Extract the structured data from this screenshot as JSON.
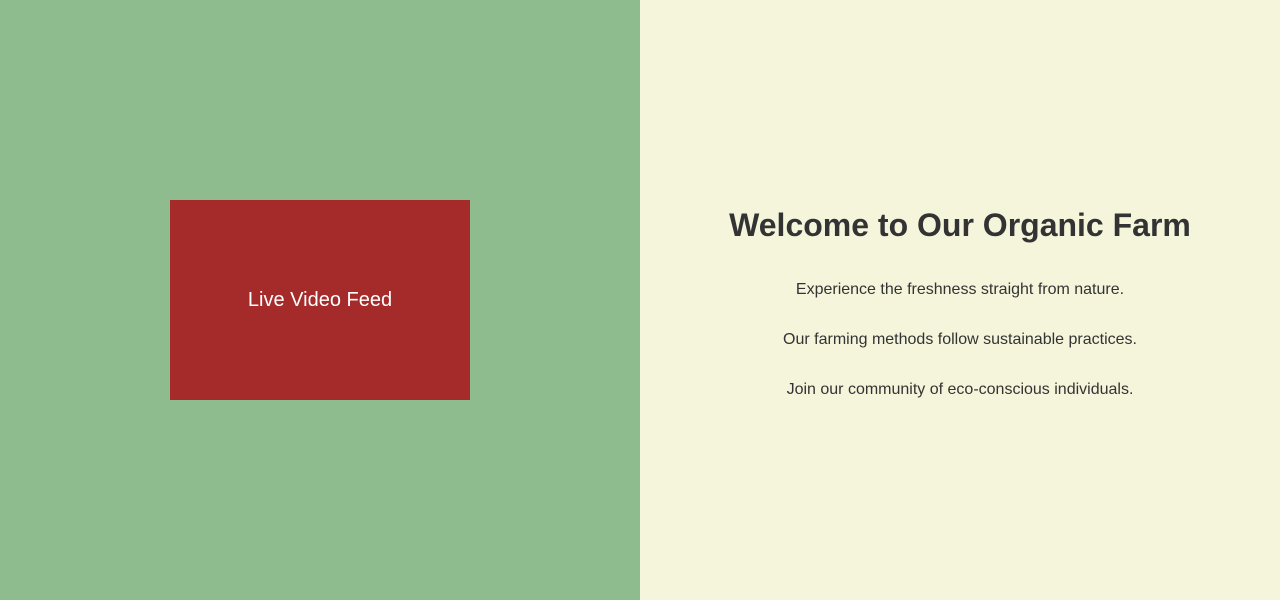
{
  "left": {
    "video": {
      "label": "Live Video Feed"
    }
  },
  "right": {
    "title": "Welcome to Our Organic Farm",
    "paragraphs": [
      "Experience the freshness straight from nature.",
      "Our farming methods follow sustainable practices.",
      "Join our community of eco-conscious individuals."
    ]
  },
  "colors": {
    "left_background": "#8fbc8f",
    "video_background": "#a52a2a",
    "right_background": "#f5f5dc",
    "text": "#333333"
  }
}
